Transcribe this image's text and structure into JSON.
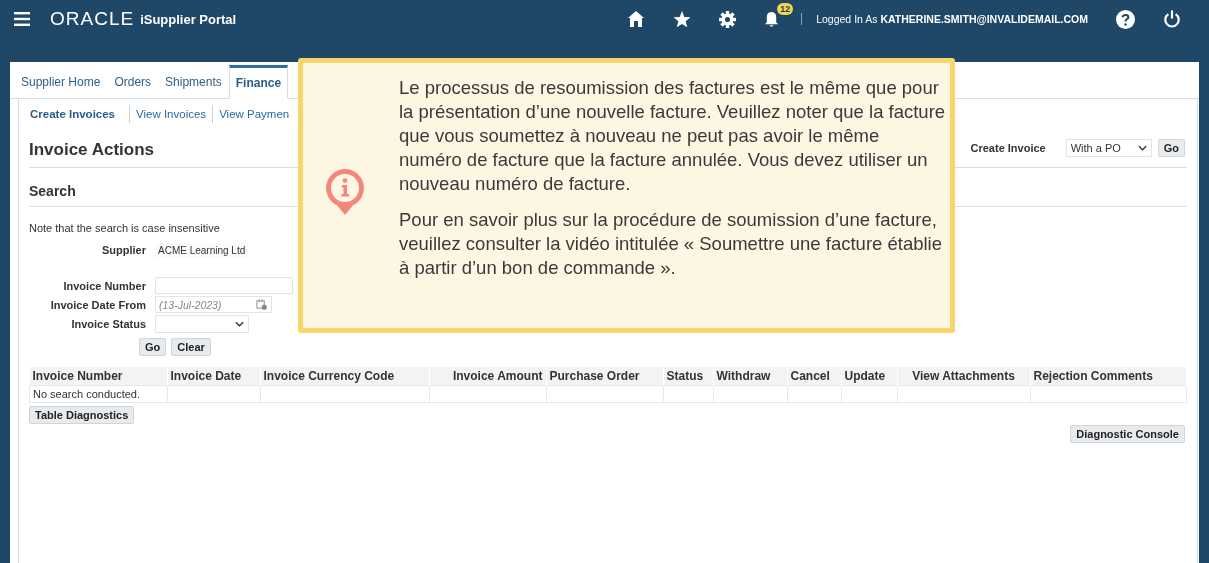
{
  "header": {
    "logo": "ORACLE",
    "product": "iSupplier Portal",
    "notification_count": "12",
    "login_text": "Logged In As **KATHERINE.SMITH@INVALIDEMAIL.COM**"
  },
  "tabs": [
    {
      "label": "Supplier Home",
      "selected": false
    },
    {
      "label": "Orders",
      "selected": false
    },
    {
      "label": "Shipments",
      "selected": false
    },
    {
      "label": "Finance",
      "selected": true
    }
  ],
  "subtabs": [
    {
      "label": "Create Invoices",
      "selected": true
    },
    {
      "label": "View Invoices",
      "selected": false
    },
    {
      "label": "View Paymen",
      "selected": false
    }
  ],
  "page_title": "Invoice Actions",
  "create_invoice": {
    "label": "Create Invoice",
    "value": "With a PO",
    "button": "Go"
  },
  "search": {
    "title": "Search",
    "note": "Note that the search is case insensitive",
    "supplier_label": "Supplier",
    "supplier_value": "ACME Learning Ltd",
    "fields": [
      {
        "label": "Invoice Number",
        "kind": "text"
      },
      {
        "label": "Invoice Date From",
        "kind": "date",
        "placeholder": "(13-Jul-2023)"
      },
      {
        "label": "Invoice Status",
        "kind": "select"
      }
    ],
    "buttons": [
      "Go",
      "Clear"
    ]
  },
  "table": {
    "columns": [
      "Invoice Number",
      "Invoice Date",
      "Invoice Currency Code",
      "Invoice Amount",
      "Purchase Order",
      "Status",
      "Withdraw",
      "Cancel",
      "Update",
      "View Attachments",
      "Rejection Comments"
    ],
    "empty_message": "No search conducted.",
    "button": "Table Diagnostics"
  },
  "console_button": "Diagnostic Console",
  "callout": {
    "paragraphs": [
      "Le processus de resoumission des factures est le même que pour la présentation d’une nouvelle facture. Veuillez noter que la facture que vous soumettez à nouveau ne peut pas avoir le même numéro de facture que la facture annulée. Vous devez utiliser un nouveau numéro de facture.",
      "Pour en savoir plus sur la procédure de soumission d’une facture, veuillez consulter la vidéo intitulée « Soumettre une facture établie à partir d’un bon de commande »."
    ]
  }
}
